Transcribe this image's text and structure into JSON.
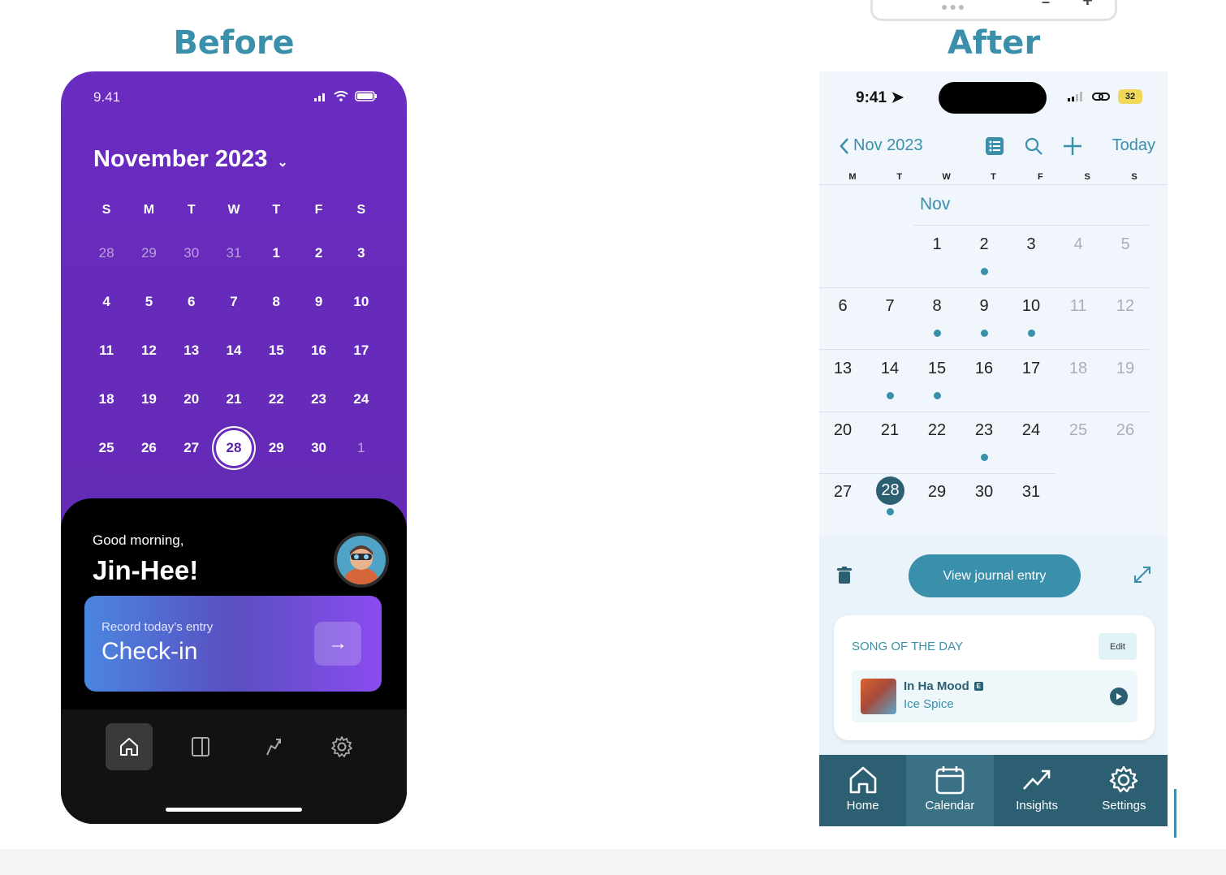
{
  "headings": {
    "before": "Before",
    "after": "After"
  },
  "before": {
    "status_time": "9.41",
    "month_title": "November 2023",
    "weekdays": [
      "S",
      "M",
      "T",
      "W",
      "T",
      "F",
      "S"
    ],
    "days": [
      {
        "d": "28",
        "m": true
      },
      {
        "d": "29",
        "m": true
      },
      {
        "d": "30",
        "m": true
      },
      {
        "d": "31",
        "m": true
      },
      {
        "d": "1"
      },
      {
        "d": "2"
      },
      {
        "d": "3"
      },
      {
        "d": "4"
      },
      {
        "d": "5"
      },
      {
        "d": "6"
      },
      {
        "d": "7"
      },
      {
        "d": "8"
      },
      {
        "d": "9"
      },
      {
        "d": "10"
      },
      {
        "d": "11"
      },
      {
        "d": "12"
      },
      {
        "d": "13"
      },
      {
        "d": "14"
      },
      {
        "d": "15"
      },
      {
        "d": "16"
      },
      {
        "d": "17"
      },
      {
        "d": "18"
      },
      {
        "d": "19"
      },
      {
        "d": "20"
      },
      {
        "d": "21"
      },
      {
        "d": "22"
      },
      {
        "d": "23"
      },
      {
        "d": "24"
      },
      {
        "d": "25"
      },
      {
        "d": "26"
      },
      {
        "d": "27"
      },
      {
        "d": "28",
        "sel": true
      },
      {
        "d": "29"
      },
      {
        "d": "30"
      },
      {
        "d": "1",
        "m": true
      }
    ],
    "greeting": "Good morning,",
    "name": "Jin-Hee!",
    "checkin_small": "Record today’s entry",
    "checkin_big": "Check-in",
    "nav_icons": [
      "home-icon",
      "journal-icon",
      "insights-icon",
      "settings-icon"
    ]
  },
  "after": {
    "status_time": "9:41",
    "battery": "32",
    "header_month": "Nov 2023",
    "today_label": "Today",
    "weekdays": [
      "M",
      "T",
      "W",
      "T",
      "F",
      "S",
      "S"
    ],
    "month_label": "Nov",
    "days": [
      {
        "d": "1",
        "col": 2,
        "row": 0
      },
      {
        "d": "2",
        "col": 3,
        "row": 0,
        "dot": true
      },
      {
        "d": "3",
        "col": 4,
        "row": 0
      },
      {
        "d": "4",
        "col": 5,
        "row": 0,
        "m": true
      },
      {
        "d": "5",
        "col": 6,
        "row": 0,
        "m": true
      },
      {
        "d": "6",
        "col": 0,
        "row": 1
      },
      {
        "d": "7",
        "col": 1,
        "row": 1
      },
      {
        "d": "8",
        "col": 2,
        "row": 1,
        "dot": true
      },
      {
        "d": "9",
        "col": 3,
        "row": 1,
        "dot": true
      },
      {
        "d": "10",
        "col": 4,
        "row": 1,
        "dot": true
      },
      {
        "d": "11",
        "col": 5,
        "row": 1,
        "m": true
      },
      {
        "d": "12",
        "col": 6,
        "row": 1,
        "m": true
      },
      {
        "d": "13",
        "col": 0,
        "row": 2
      },
      {
        "d": "14",
        "col": 1,
        "row": 2,
        "dot": true
      },
      {
        "d": "15",
        "col": 2,
        "row": 2,
        "dot": true
      },
      {
        "d": "16",
        "col": 3,
        "row": 2
      },
      {
        "d": "17",
        "col": 4,
        "row": 2
      },
      {
        "d": "18",
        "col": 5,
        "row": 2,
        "m": true
      },
      {
        "d": "19",
        "col": 6,
        "row": 2,
        "m": true
      },
      {
        "d": "20",
        "col": 0,
        "row": 3
      },
      {
        "d": "21",
        "col": 1,
        "row": 3
      },
      {
        "d": "22",
        "col": 2,
        "row": 3
      },
      {
        "d": "23",
        "col": 3,
        "row": 3,
        "dot": true
      },
      {
        "d": "24",
        "col": 4,
        "row": 3
      },
      {
        "d": "25",
        "col": 5,
        "row": 3,
        "m": true
      },
      {
        "d": "26",
        "col": 6,
        "row": 3,
        "m": true
      },
      {
        "d": "27",
        "col": 0,
        "row": 4
      },
      {
        "d": "28",
        "col": 1,
        "row": 4,
        "dot": true,
        "sel": true
      },
      {
        "d": "29",
        "col": 2,
        "row": 4
      },
      {
        "d": "30",
        "col": 3,
        "row": 4
      },
      {
        "d": "31",
        "col": 4,
        "row": 4
      }
    ],
    "view_entry_label": "View journal entry",
    "song_section_title": "SONG OF THE DAY",
    "edit_label": "Edit",
    "track_name": "In Ha Mood",
    "explicit_badge": "E",
    "track_artist": "Ice Spice",
    "nav": [
      {
        "label": "Home",
        "icon": "home-icon"
      },
      {
        "label": "Calendar",
        "icon": "calendar-icon",
        "active": true
      },
      {
        "label": "Insights",
        "icon": "insights-icon"
      },
      {
        "label": "Settings",
        "icon": "settings-icon"
      }
    ]
  },
  "colors": {
    "heading_teal": "#3a8fab",
    "before_purple": "#6a2bc0",
    "after_navy": "#2c5f72",
    "after_bg": "#f0f6fc"
  }
}
